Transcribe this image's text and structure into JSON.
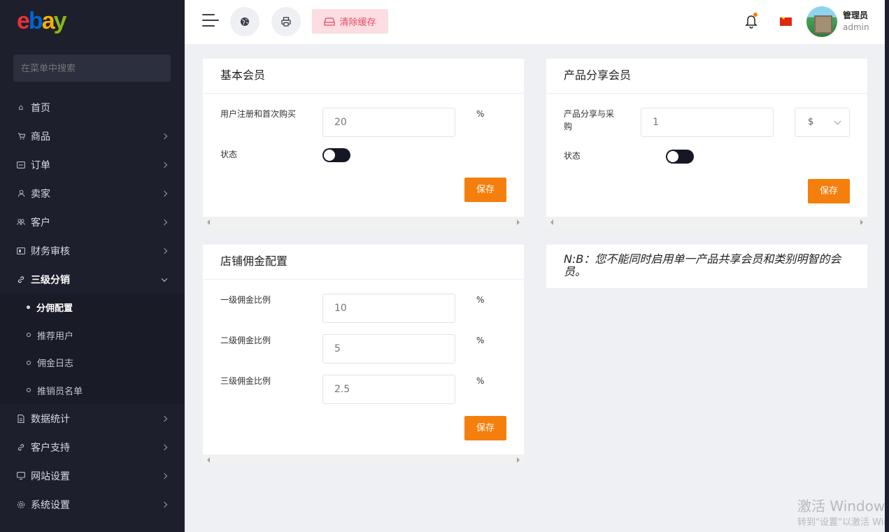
{
  "brand": {
    "logo_e": "e",
    "logo_b": "b",
    "logo_a": "a",
    "logo_y": "y"
  },
  "sidebar": {
    "search_placeholder": "在菜单中搜索",
    "items": [
      {
        "label": "首页",
        "icon": "home-icon"
      },
      {
        "label": "商品",
        "icon": "cart-icon"
      },
      {
        "label": "订单",
        "icon": "order-icon"
      },
      {
        "label": "卖家",
        "icon": "user-icon"
      },
      {
        "label": "客户",
        "icon": "users-icon"
      },
      {
        "label": "财务审核",
        "icon": "finance-icon"
      },
      {
        "label": "三级分销",
        "icon": "link-icon"
      },
      {
        "label": "数据统计",
        "icon": "document-icon"
      },
      {
        "label": "客户支持",
        "icon": "link-icon"
      },
      {
        "label": "网站设置",
        "icon": "monitor-icon"
      },
      {
        "label": "系统设置",
        "icon": "gear-icon"
      }
    ],
    "subitems": [
      "分佣配置",
      "推荐用户",
      "佣金日志",
      "推销员名单"
    ]
  },
  "header": {
    "clear_cache_label": "清除缓存",
    "user_name": "管理员",
    "user_role": "admin"
  },
  "basic_member": {
    "title": "基本会员",
    "field_label": "用户注册和首次购买",
    "field_value": "20",
    "unit": "%",
    "status_label": "状态",
    "save_label": "保存"
  },
  "product_share": {
    "title": "产品分享会员",
    "field_label": "产品分享与采购",
    "field_value": "1",
    "currency": "$",
    "status_label": "状态",
    "save_label": "保存"
  },
  "shop_commission": {
    "title": "店铺佣金配置",
    "rows": [
      {
        "label": "一级佣金比例",
        "value": "10",
        "unit": "%"
      },
      {
        "label": "二级佣金比例",
        "value": "5",
        "unit": "%"
      },
      {
        "label": "三级佣金比例",
        "value": "2.5",
        "unit": "%"
      }
    ],
    "save_label": "保存"
  },
  "note": "N:B：您不能同时启用单一产品共享会员和类别明智的会员。",
  "watermark": {
    "line1": "激活 Windows",
    "line2": "转到\"设置\"以激活 Windows。"
  }
}
